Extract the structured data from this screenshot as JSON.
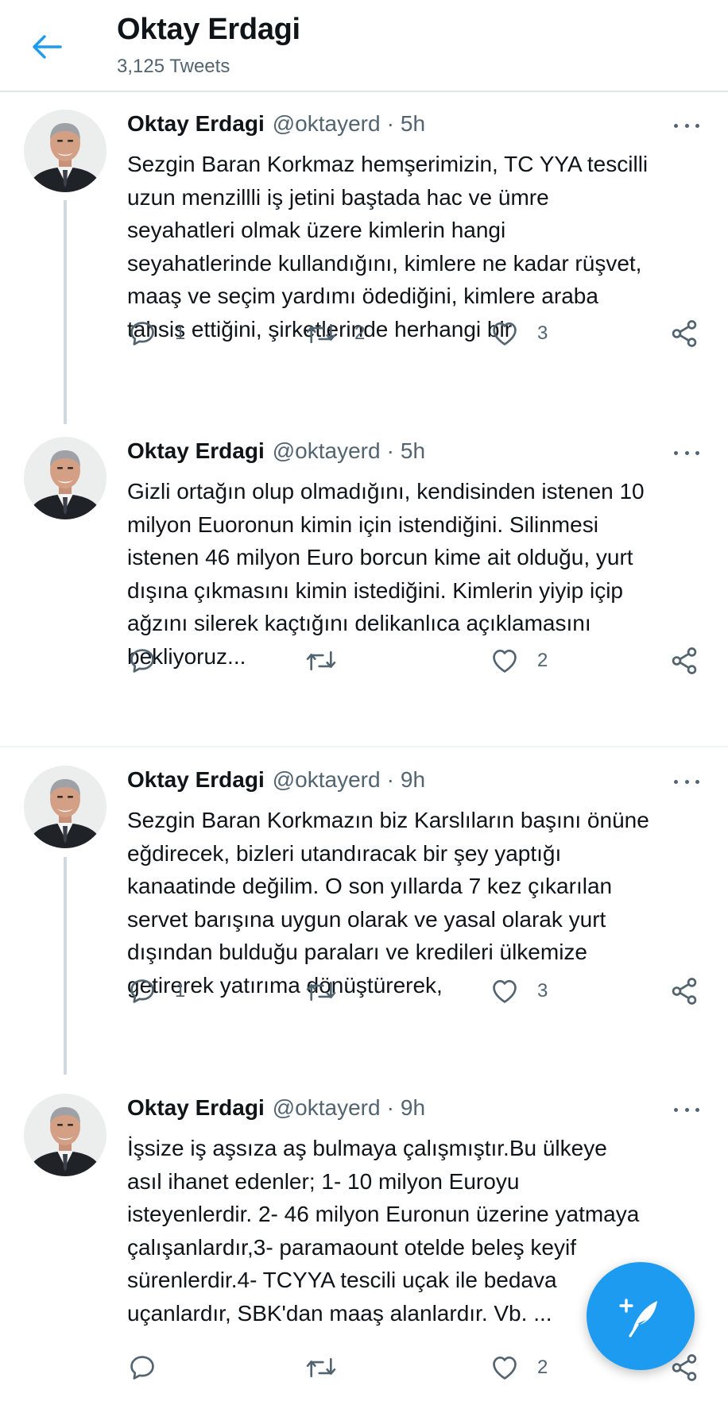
{
  "header": {
    "title": "Oktay Erdagi",
    "tweet_count": "3,125 Tweets"
  },
  "colors": {
    "accent": "#1d9bf0",
    "muted": "#536471",
    "text": "#0f1419",
    "thread_line": "#cfd9de"
  },
  "icons": {
    "back": "arrow-left-icon",
    "reply": "reply-icon",
    "retweet": "retweet-icon",
    "like": "heart-icon",
    "share": "share-icon",
    "compose": "compose-feather-icon"
  },
  "tweets": [
    {
      "name": "Oktay Erdagi",
      "handle": "@oktayerd",
      "dot": "·",
      "time": "5h",
      "lines": [
        "Sezgin Baran Korkmaz hemşerimizin, TC YYA tescilli",
        "uzun menzillli iş jetini baştada hac ve ümre",
        "seyahatleri olmak üzere kimlerin  hangi",
        "seyahatlerinde kullandığını, kimlere ne kadar rüşvet,",
        "maaş ve seçim yardımı ödediğini, kimlere araba",
        "tahsis ettiğini, şirketlerinde herhangi bir"
      ],
      "replies": "1",
      "retweets": "2",
      "likes": "3"
    },
    {
      "name": "Oktay Erdagi",
      "handle": "@oktayerd",
      "dot": "·",
      "time": "5h",
      "lines": [
        "Gizli ortağın olup olmadığını, kendisinden istenen 10",
        "milyon Euoronun kimin için istendiğini. Silinmesi",
        "istenen 46 milyon Euro borcun kime ait olduğu, yurt",
        "dışına çıkmasını kimin istediğini. Kimlerin yiyip içip",
        "ağzını silerek kaçtığını delikanlıca açıklamasını",
        "bekliyoruz..."
      ],
      "replies": "",
      "retweets": "",
      "likes": "2"
    },
    {
      "name": "Oktay Erdagi",
      "handle": "@oktayerd",
      "dot": "·",
      "time": "9h",
      "lines": [
        "Sezgin Baran Korkmazın biz Karslıların başını önüne",
        "eğdirecek, bizleri utandıracak bir şey yaptığı",
        "kanaatinde değilim. O son yıllarda 7 kez çıkarılan",
        "servet barışına uygun olarak ve yasal olarak yurt",
        "dışından bulduğu paraları ve kredileri ülkemize",
        "getirerek yatırıma dönüştürerek,"
      ],
      "replies": "1",
      "retweets": "",
      "likes": "3"
    },
    {
      "name": "Oktay Erdagi",
      "handle": "@oktayerd",
      "dot": "·",
      "time": "9h",
      "lines": [
        "İşsize iş aşsıza aş bulmaya çalışmıştır.Bu ülkeye",
        "asıl ihanet edenler; 1- 10 milyon Euroyu",
        "isteyenlerdir. 2- 46 milyon Euronun üzerine yatmaya",
        "çalışanlardır,3- paramaount otelde beleş keyif",
        "sürenlerdir.4- TCYYA tescili uçak ile bedava",
        "uçanlardır, SBK'dan maaş alanlardır. Vb. ..."
      ],
      "replies": "",
      "retweets": "",
      "likes": "2"
    }
  ]
}
